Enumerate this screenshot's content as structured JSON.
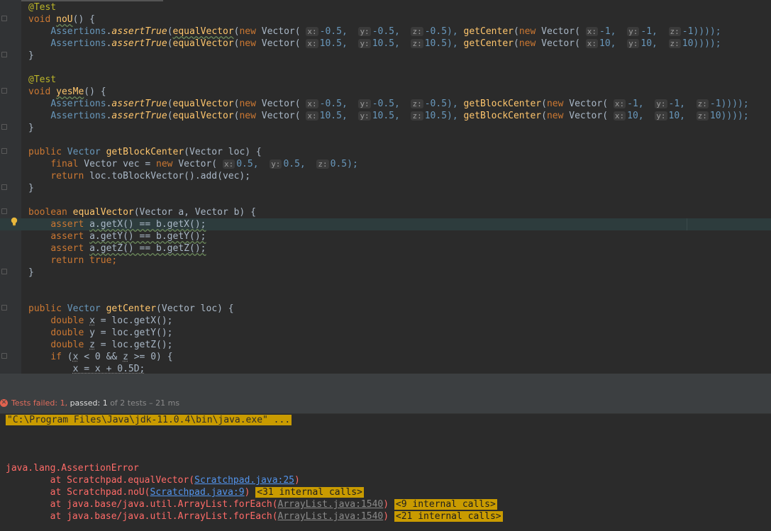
{
  "editor": {
    "l1": "@Test",
    "l2": {
      "kw": "void",
      "fn": "noU",
      "rest": "() {"
    },
    "l3": {
      "cls": "Assertions",
      "dot": ".",
      "stat": "assertTrue",
      "p1": "(",
      "fn": "equalVector",
      "p2": "(",
      "new1": "new",
      "sp": " ",
      "v1": "Vector",
      "p3": "(",
      "x": "x:",
      "xv": "-0.5,",
      "y": "y:",
      "yv": "-0.5,",
      "z": "z:",
      "zv": "-0.5),",
      "gc": "getCenter",
      "p4": "(",
      "new2": "new",
      "v2": "Vector",
      "p5": "(",
      "x2": "x:",
      "xv2": "-1,",
      "y2": "y:",
      "yv2": "-1,",
      "z2": "z:",
      "zv2": "-1))));"
    },
    "l4": {
      "xv": "10.5,",
      "yv": "10.5,",
      "zv": "10.5),",
      "xv2": "10,",
      "yv2": "10,",
      "zv2": "10))));"
    },
    "close": "}",
    "l7": "@Test",
    "l8": {
      "kw": "void",
      "fn": "yesMe",
      "rest": "() {"
    },
    "l9": {
      "gc": "getBlockCenter",
      "xv": "-0.5,",
      "yv": "-0.5,",
      "zv": "-0.5),",
      "xv2": "-1,",
      "yv2": "-1,",
      "zv2": "-1))));"
    },
    "l10": {
      "xv": "10.5,",
      "yv": "10.5,",
      "zv": "10.5),",
      "xv2": "10,",
      "yv2": "10,",
      "zv2": "10))));"
    },
    "l13": {
      "kw": "public",
      "cls": "Vector",
      "fn": "getBlockCenter",
      "rest": "(Vector loc) {"
    },
    "l14": {
      "kw1": "final",
      "t": "Vector vec =",
      "kw2": "new",
      "v": "Vector(",
      "xv": "0.5,",
      "yv": "0.5,",
      "zv": "0.5);"
    },
    "l15": {
      "kw": "return",
      "rest": "loc.toBlockVector().add(vec);"
    },
    "l17": {
      "kw": "boolean",
      "fn": "equalVector",
      "rest": "(Vector a, Vector b) {"
    },
    "l18": {
      "kw": "assert",
      "expr": "a.getX() == b.getX();"
    },
    "l19": {
      "kw": "assert",
      "expr": "a.getY() == b.getY();"
    },
    "l20": {
      "kw": "assert",
      "expr": "a.getZ() == b.getZ();"
    },
    "l21": {
      "kw": "return",
      "val": "true;"
    },
    "l25": {
      "kw": "public",
      "cls": "Vector",
      "fn": "getCenter",
      "rest": "(Vector loc) {"
    },
    "l26": {
      "kw": "double",
      "v": "x",
      "rest": "= loc.getX();"
    },
    "l27": {
      "kw": "double",
      "v": "y",
      "rest": "= loc.getY();"
    },
    "l28": {
      "kw": "double",
      "v": "z",
      "rest": "= loc.getZ();"
    },
    "l29": {
      "kw": "if",
      "a": "(",
      "x": "x",
      "b": "< 0 &&",
      "z": "z",
      "c": ">= 0) {"
    },
    "l30": "x = x + 0.5D;"
  },
  "run": {
    "failed": "Tests failed: 1,",
    "passed": "passed: 1",
    "rest": "of 2 tests – 21 ms"
  },
  "console": {
    "cmd": "\"C:\\Program Files\\Java\\jdk-11.0.4\\bin\\java.exe\" ...",
    "error": "java.lang.AssertionError",
    "t1_pre": "\tat Scratchpad.equalVector(",
    "t1_link": "Scratchpad.java:25",
    "t1_post": ")",
    "t2_pre": "\tat Scratchpad.noU(",
    "t2_link": "Scratchpad.java:9",
    "t2_post": ")",
    "t2_chip": "<31 internal calls>",
    "t3_pre": "\tat java.base/java.util.ArrayList.forEach(",
    "t3_link": "ArrayList.java:1540",
    "t3_post": ")",
    "t3_chip": "<9 internal calls>",
    "t4_pre": "\tat java.base/java.util.ArrayList.forEach(",
    "t4_link": "ArrayList.java:1540",
    "t4_post": ")",
    "t4_chip": "<21 internal calls>"
  }
}
